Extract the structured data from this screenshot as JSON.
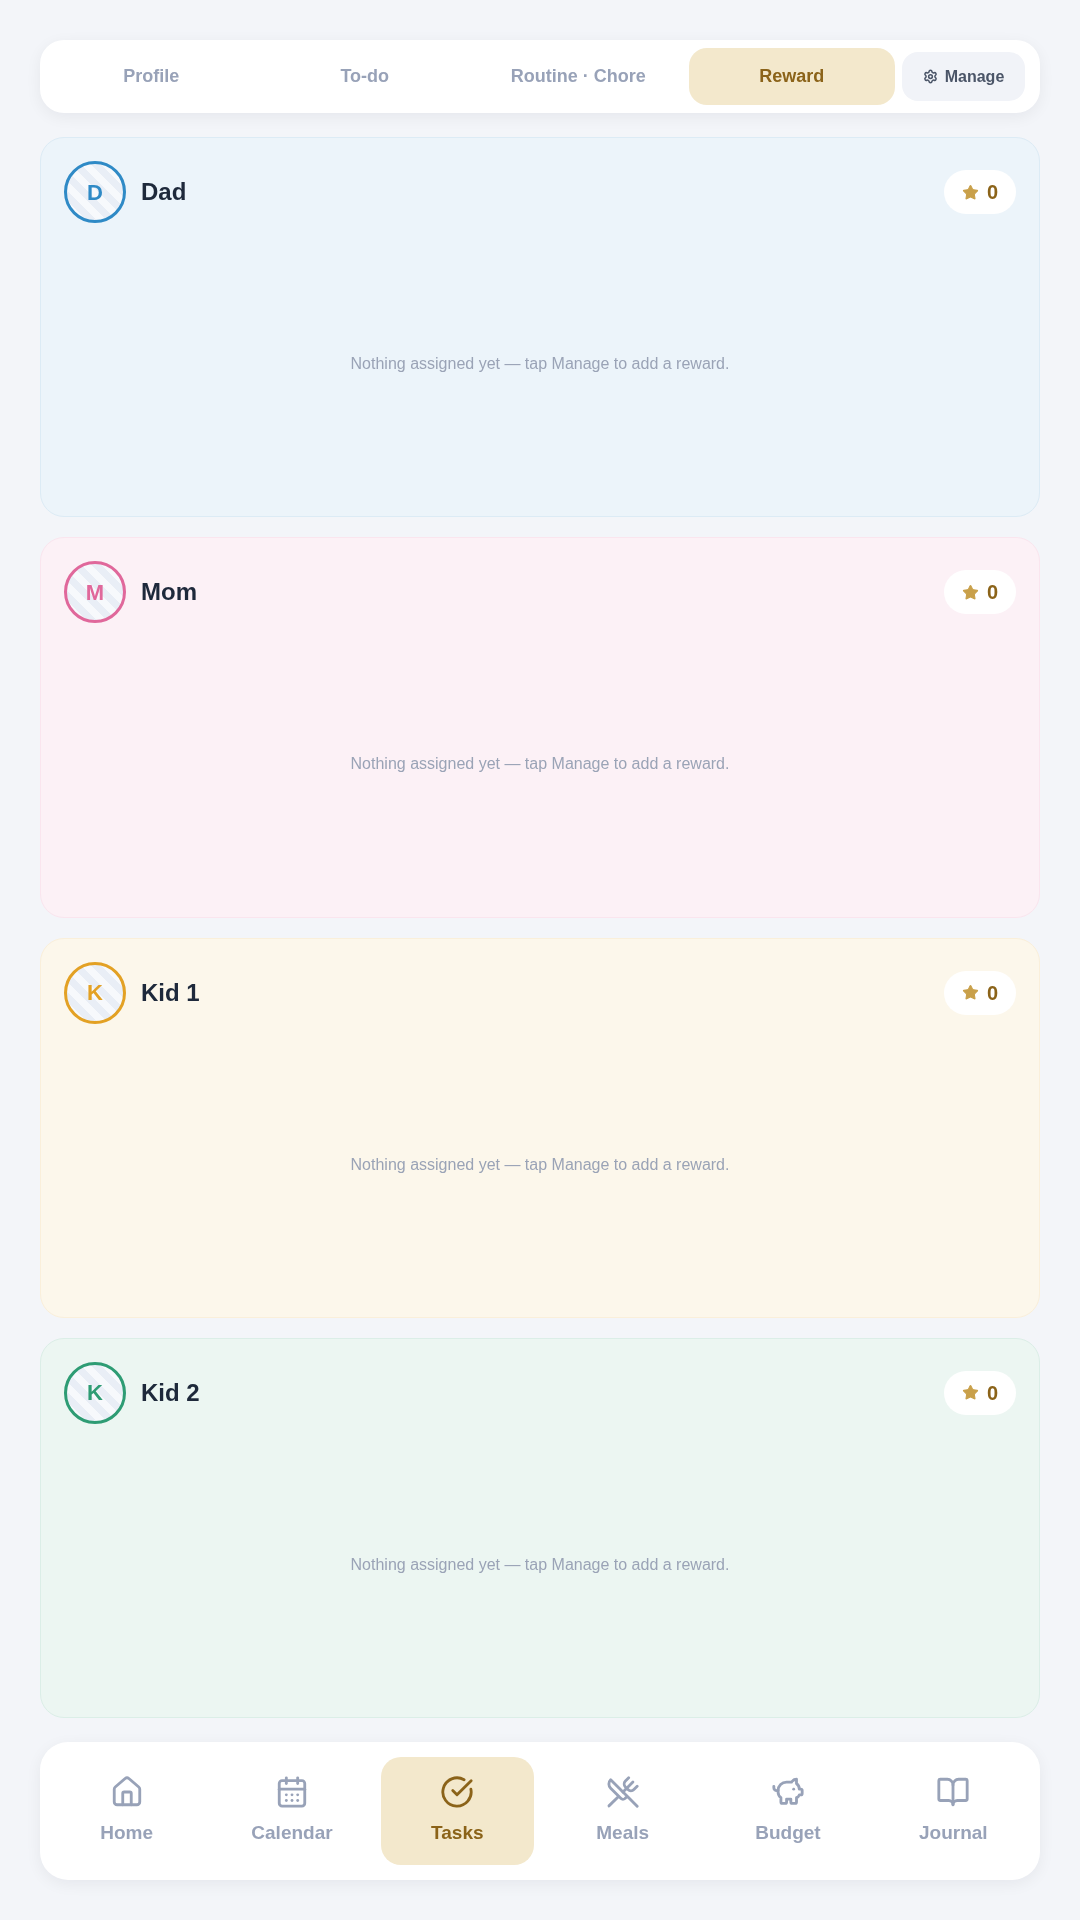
{
  "tabs": [
    {
      "label": "Profile",
      "selected": false
    },
    {
      "label": "To-do",
      "selected": false
    },
    {
      "label": "Routine · Chore",
      "selected": false
    },
    {
      "label": "Reward",
      "selected": true
    }
  ],
  "manage_button": {
    "label": "Manage"
  },
  "members": [
    {
      "initial": "D",
      "name": "Dad",
      "color": "#2f8ac6",
      "points": "0",
      "empty_message": "Nothing assigned yet — tap Manage to add a reward."
    },
    {
      "initial": "M",
      "name": "Mom",
      "color": "#e0689b",
      "points": "0",
      "empty_message": "Nothing assigned yet — tap Manage to add a reward."
    },
    {
      "initial": "K",
      "name": "Kid 1",
      "color": "#e3a124",
      "points": "0",
      "empty_message": "Nothing assigned yet — tap Manage to add a reward."
    },
    {
      "initial": "K",
      "name": "Kid 2",
      "color": "#2e9c74",
      "points": "0",
      "empty_message": "Nothing assigned yet — tap Manage to add a reward."
    }
  ],
  "bottom_nav": [
    {
      "label": "Home",
      "selected": false
    },
    {
      "label": "Calendar",
      "selected": false
    },
    {
      "label": "Tasks",
      "selected": true
    },
    {
      "label": "Meals",
      "selected": false
    },
    {
      "label": "Budget",
      "selected": false
    },
    {
      "label": "Journal",
      "selected": false
    }
  ]
}
